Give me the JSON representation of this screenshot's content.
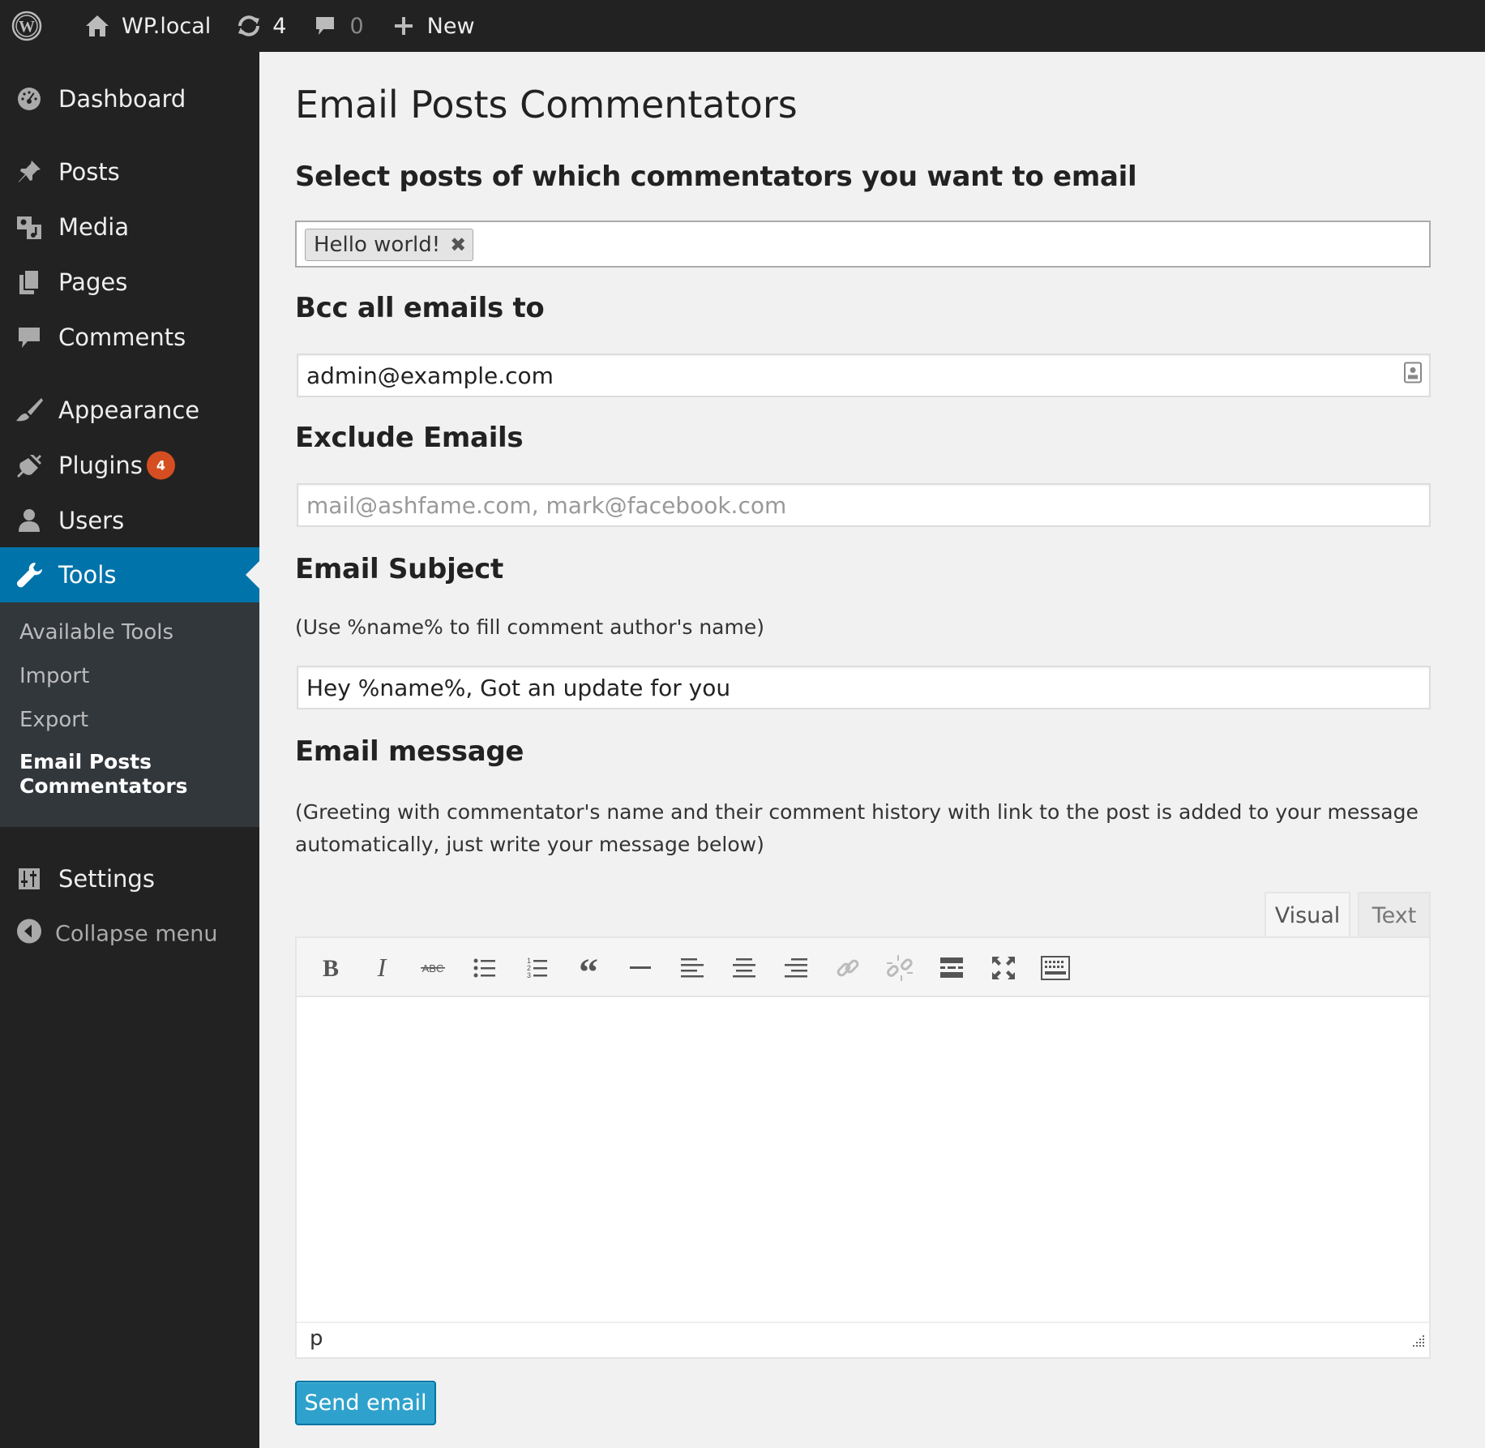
{
  "admin_bar": {
    "site_name": "WP.local",
    "updates_count": "4",
    "comments_count": "0",
    "new_label": "New"
  },
  "sidebar": {
    "items": [
      {
        "label": "Dashboard",
        "icon": "dashboard-icon"
      },
      {
        "label": "Posts",
        "icon": "pin-icon"
      },
      {
        "label": "Media",
        "icon": "media-icon"
      },
      {
        "label": "Pages",
        "icon": "pages-icon"
      },
      {
        "label": "Comments",
        "icon": "comment-icon"
      },
      {
        "label": "Appearance",
        "icon": "brush-icon"
      },
      {
        "label": "Plugins",
        "icon": "plug-icon",
        "badge": "4"
      },
      {
        "label": "Users",
        "icon": "user-icon"
      },
      {
        "label": "Tools",
        "icon": "wrench-icon",
        "current": true
      },
      {
        "label": "Settings",
        "icon": "sliders-icon"
      }
    ],
    "submenu": [
      "Available Tools",
      "Import",
      "Export",
      "Email Posts Commentators"
    ],
    "submenu_current_line1": "Email Posts",
    "submenu_current_line2": "Commentators",
    "collapse_label": "Collapse menu"
  },
  "main": {
    "title": "Email Posts Commentators",
    "select_posts_heading": "Select posts of which commentators you want to email",
    "selected_post_token": "Hello world!",
    "bcc_heading": "Bcc all emails to",
    "bcc_value": "admin@example.com",
    "exclude_heading": "Exclude Emails",
    "exclude_placeholder": "mail@ashfame.com, mark@facebook.com",
    "subject_heading": "Email Subject",
    "subject_hint": "(Use %name% to fill comment author's name)",
    "subject_value": "Hey %name%, Got an update for you",
    "message_heading": "Email message",
    "message_hint": "(Greeting with commentator's name and their comment history with link to the post is added to your message automatically, just write your message below)",
    "editor": {
      "tab_visual": "Visual",
      "tab_text": "Text",
      "status_path": "p",
      "toolbar_buttons": [
        "bold",
        "italic",
        "strikethrough",
        "bullet-list",
        "numbered-list",
        "blockquote",
        "horizontal-rule",
        "align-left",
        "align-center",
        "align-right",
        "insert-link",
        "remove-link",
        "read-more",
        "fullscreen",
        "toolbar-toggle"
      ]
    },
    "send_button": "Send email"
  },
  "colors": {
    "admin_bar_bg": "#222222",
    "sidebar_bg": "#222222",
    "submenu_bg": "#32373c",
    "accent": "#0073aa",
    "button_primary": "#2ea2cc",
    "badge": "#d54e21",
    "content_bg": "#f1f1f1"
  }
}
